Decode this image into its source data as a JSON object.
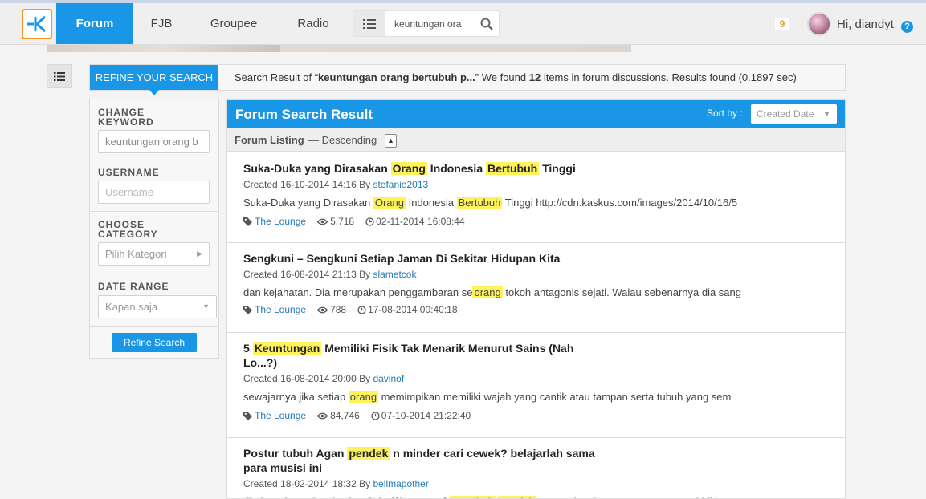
{
  "header": {
    "nav": {
      "forum": "Forum",
      "fjb": "FJB",
      "groupee": "Groupee",
      "radio": "Radio"
    },
    "search_value": "keuntungan ora",
    "notif_count": "9",
    "greeting": "Hi, diandyt",
    "help": "?"
  },
  "summary": {
    "tab": "REFINE YOUR SEARCH",
    "pre": "Search Result of “",
    "query": "keuntungan orang bertubuh p...",
    "mid": "” We found ",
    "count": "12",
    "post": " items in forum discussions. Results found (0.1897 sec)"
  },
  "sidebar": {
    "keyword_label": "CHANGE KEYWORD",
    "keyword_value": "keuntungan orang b",
    "username_label": "USERNAME",
    "username_placeholder": "Username",
    "category_label": "CHOOSE CATEGORY",
    "category_placeholder": "Pilih Kategori",
    "date_label": "DATE RANGE",
    "date_value": "Kapan saja",
    "refine_button": "Refine Search"
  },
  "results": {
    "title": "Forum Search Result",
    "sort_label": "Sort by :",
    "sort_value": "Created Date",
    "listing_label": "Forum Listing",
    "listing_dir": "— Descending",
    "items": [
      {
        "title_parts": [
          "Suka-Duka yang Dirasakan ",
          "Orang",
          " Indonesia ",
          "Bertubuh",
          " Tinggi"
        ],
        "created": "Created 16-10-2014 14:16 By ",
        "user": "stefanie2013",
        "snippet_parts": [
          "Suka-Duka yang Dirasakan ",
          "Orang",
          " Indonesia ",
          "Bertubuh",
          " Tinggi http://cdn.kaskus.com/images/2014/10/16/5"
        ],
        "category": "The Lounge",
        "views": "5,718",
        "last": "02-11-2014 16:08:44"
      },
      {
        "title_parts": [
          "Sengkuni – Sengkuni Setiap Jaman Di Sekitar Hidupan Kita"
        ],
        "created": "Created 16-08-2014 21:13 By ",
        "user": "slametcok",
        "snippet_parts": [
          "dan kejahatan. Dia merupakan penggambaran se",
          "orang",
          " tokoh antagonis sejati. Walau sebenarnya dia sang"
        ],
        "category": "The Lounge",
        "views": "788",
        "last": "17-08-2014 00:40:18"
      },
      {
        "title_parts": [
          "5 ",
          "Keuntungan",
          " Memiliki Fisik Tak Menarik Menurut Sains (Nah Lo...?)"
        ],
        "created": "Created 16-08-2014 20:00 By ",
        "user": "davinof",
        "snippet_parts": [
          "sewajarnya jika setiap ",
          "orang",
          " memimpikan memiliki wajah yang cantik atau tampan serta tubuh yang sem"
        ],
        "category": "The Lounge",
        "views": "84,746",
        "last": "07-10-2014 21:22:40"
      },
      {
        "title_parts": [
          "Postur tubuh Agan ",
          "pendek",
          " n minder cari cewek? belajarlah sama para musisi ini"
        ],
        "created": "Created 18-02-2014 18:32 By ",
        "user": "bellmapother",
        "snippet_parts": [
          "di Thread Ane ilovekaskus [/size][/CENTER] ",
          "Bertubuh",
          " ",
          "pendek",
          " merupakan kekurangan yang pasti bikin"
        ],
        "category": "",
        "views": "",
        "last": ""
      }
    ]
  },
  "colors": {
    "brand_blue": "#1997e6",
    "highlight": "#fff35c",
    "logo_orange": "#f7941d",
    "link": "#2479b5"
  }
}
